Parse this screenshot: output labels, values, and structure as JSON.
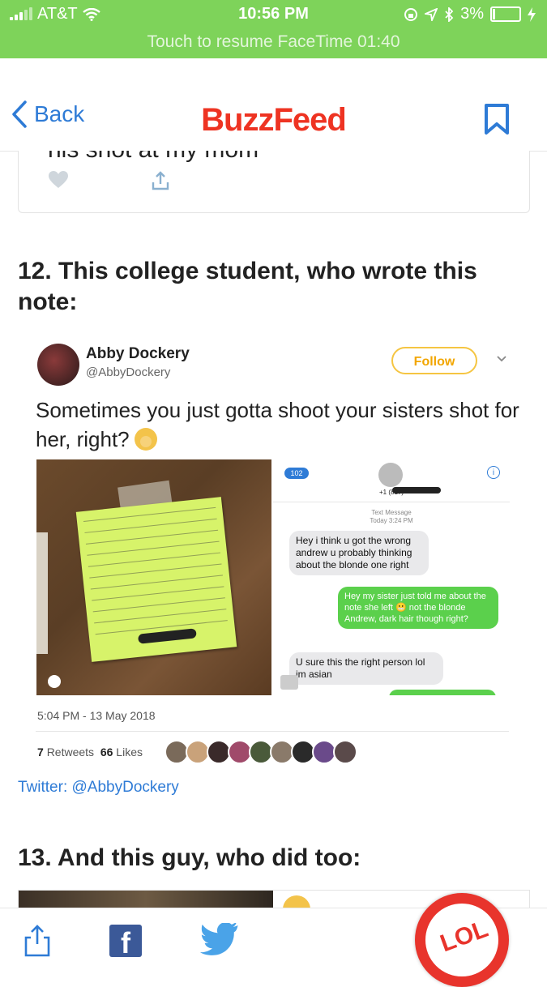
{
  "status_bar": {
    "carrier": "AT&T",
    "time": "10:56 PM",
    "battery": "3%",
    "facetime_banner": "Touch to resume FaceTime 01:40"
  },
  "nav": {
    "back_label": "Back",
    "logo": "BuzzFeed"
  },
  "previous_tweet": {
    "text_fragment": "his shot at my mom"
  },
  "items": [
    {
      "number_title": "12. This college student, who wrote this note:"
    },
    {
      "number_title": "13. And this guy, who did too:"
    }
  ],
  "tweet": {
    "author_name": "Abby Dockery",
    "author_handle": "@AbbyDockery",
    "follow_label": "Follow",
    "text": "Sometimes you just gotta shoot your sisters shot for her, right?",
    "timestamp": "5:04 PM - 13 May 2018",
    "retweets_count": "7",
    "retweets_label": "Retweets",
    "likes_count": "66",
    "likes_label": "Likes",
    "source_link": "Twitter: @AbbyDockery",
    "liker_colors": [
      "#7a6a5a",
      "#c9a27a",
      "#3a2a2a",
      "#a04a6a",
      "#4a5a3a",
      "#8a7a6a",
      "#2a2a2a",
      "#6a4a8a",
      "#5a4a4a"
    ]
  },
  "screenshot": {
    "back_count": "102",
    "phone_number": "+1 (817)",
    "meta_line1": "Text Message",
    "meta_line2": "Today 3:24 PM",
    "bubble1": "Hey i think u got the wrong andrew u probably thinking about the blonde one right",
    "bubble2": "Hey my sister just told me about the note she left 😬 not the blonde Andrew, dark hair though right?",
    "bubble3": "U sure this the right person lol im asian"
  },
  "sticky_note": {
    "text": "Hi Andrew, this may seem a little weird, but my sister Darcy Dockery has seen you around the dorm and she'd really like to get to know you, but she's pretty shy. I promise she's a good person. Her number is (806)"
  }
}
